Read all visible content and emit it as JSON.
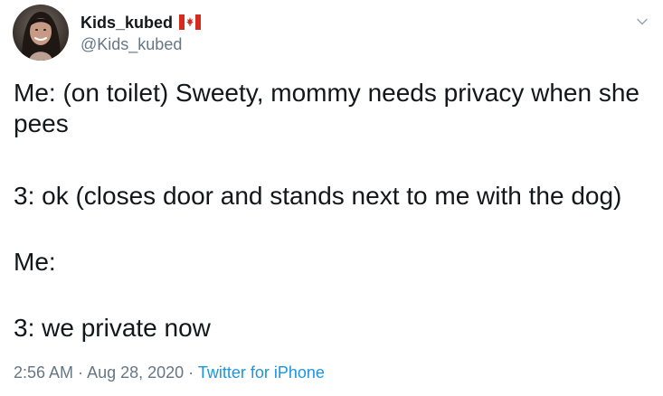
{
  "user": {
    "display_name": "Kids_kubed",
    "flag_icon": "canada-flag-icon",
    "handle": "@Kids_kubed"
  },
  "tweet": {
    "lines": [
      "Me: (on toilet) Sweety, mommy needs privacy when she pees",
      "3: ok (closes door and stands next to me with the dog)",
      "Me:",
      "3: we private now"
    ]
  },
  "meta": {
    "time": "2:56 AM",
    "separator1": " · ",
    "date": "Aug 28, 2020",
    "separator2": " · ",
    "source": "Twitter for iPhone"
  },
  "colors": {
    "text": "#14171a",
    "muted": "#657786",
    "link": "#1b95e0"
  },
  "icons": {
    "menu": "chevron-down-icon"
  }
}
